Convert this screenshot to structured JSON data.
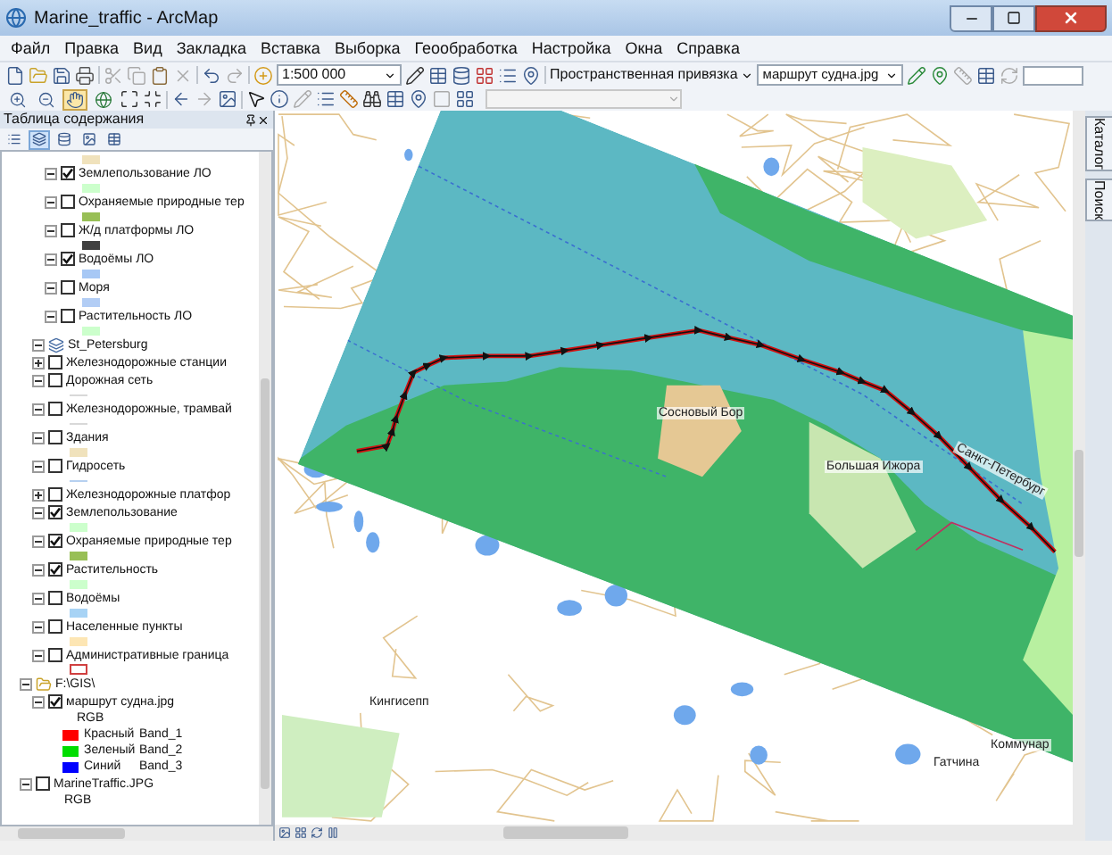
{
  "window": {
    "title": "Marine_traffic - ArcMap"
  },
  "menu": [
    "Файл",
    "Правка",
    "Вид",
    "Закладка",
    "Вставка",
    "Выборка",
    "Геообработка",
    "Настройка",
    "Окна",
    "Справка"
  ],
  "toolbar": {
    "scale": "1:500 000",
    "georef_menu": "Пространственная привязка",
    "georef_layer": "маршрут судна.jpg",
    "navigation_tools": [
      {
        "selected": false
      },
      {
        "selected": false
      },
      {
        "selected": true
      },
      {
        "selected": false
      }
    ]
  },
  "toc": {
    "title": "Таблица содержания",
    "view_buttons": [
      {
        "selected": false
      },
      {
        "selected": true
      },
      {
        "selected": false
      },
      {
        "selected": false
      },
      {
        "selected": false
      }
    ],
    "items": [
      {
        "kind": "legend",
        "swatch": {
          "kind": "fill",
          "color": "#f0e2bc"
        }
      },
      {
        "label": "Землепользование ЛО",
        "checked": true,
        "expanded": true,
        "swatch": {
          "kind": "fill",
          "color": "#ccffcc"
        }
      },
      {
        "label": "Охраняемые природные тер",
        "checked": false,
        "expanded": true,
        "swatch": {
          "kind": "fill",
          "color": "#98bf56"
        }
      },
      {
        "label": "Ж/д платформы ЛО",
        "checked": false,
        "expanded": true,
        "swatch": {
          "kind": "fill",
          "color": "#404040"
        }
      },
      {
        "label": "Водоёмы ЛО",
        "checked": true,
        "expanded": true,
        "swatch": {
          "kind": "fill",
          "color": "#a7c8f5"
        }
      },
      {
        "label": "Моря",
        "checked": false,
        "expanded": true,
        "swatch": {
          "kind": "fill",
          "color": "#b2cdf5"
        }
      },
      {
        "label": "Растительность ЛО",
        "checked": false,
        "expanded": true,
        "swatch": {
          "kind": "fill",
          "color": "#ccffcc"
        }
      },
      {
        "kind": "group",
        "label": "St_Petersburg",
        "expanded": true,
        "children": [
          {
            "label": "Железнодорожные станции",
            "checked": false,
            "expanded": false
          },
          {
            "label": "Дорожная сеть",
            "checked": false,
            "expanded": true,
            "swatch": {
              "kind": "line",
              "color": "#d8d8d8"
            }
          },
          {
            "label": "Железнодорожные, трамвай",
            "checked": false,
            "expanded": true,
            "swatch": {
              "kind": "line",
              "color": "#d8d8d8"
            }
          },
          {
            "label": "Здания",
            "checked": false,
            "expanded": true,
            "swatch": {
              "kind": "fill",
              "color": "#f0e2bc"
            }
          },
          {
            "label": "Гидросеть",
            "checked": false,
            "expanded": true,
            "swatch": {
              "kind": "line",
              "color": "#b6d0f0"
            }
          },
          {
            "label": "Железнодорожные платфор",
            "checked": false,
            "expanded": false
          },
          {
            "label": "Землепользование",
            "checked": true,
            "expanded": true,
            "swatch": {
              "kind": "fill",
              "color": "#ccffcc"
            }
          },
          {
            "label": "Охраняемые природные тер",
            "checked": true,
            "expanded": true,
            "swatch": {
              "kind": "fill",
              "color": "#98bf56"
            }
          },
          {
            "label": "Растительность",
            "checked": true,
            "expanded": true,
            "swatch": {
              "kind": "fill",
              "color": "#ccffcc"
            }
          },
          {
            "label": "Водоёмы",
            "checked": false,
            "expanded": true,
            "swatch": {
              "kind": "fill",
              "color": "#a7d3f5"
            }
          },
          {
            "label": "Населенные пункты",
            "checked": false,
            "expanded": true,
            "swatch": {
              "kind": "fill",
              "color": "#fde6b4"
            }
          },
          {
            "label": "Административные граница",
            "checked": false,
            "expanded": true,
            "swatch": {
              "kind": "outline",
              "color": "#d04040"
            }
          }
        ]
      },
      {
        "kind": "folder",
        "label": "F:\\GIS\\",
        "expanded": true,
        "children": [
          {
            "label": "маршрут судна.jpg",
            "checked": true,
            "expanded": true,
            "renderer": "RGB",
            "bands": [
              {
                "color": "#ff0000",
                "label": "Красный",
                "band": "Band_1"
              },
              {
                "color": "#00dd00",
                "label": "Зеленый",
                "band": "Band_2"
              },
              {
                "color": "#0000ff",
                "label": "Синий",
                "band": "Band_3"
              }
            ]
          }
        ]
      },
      {
        "kind": "raster",
        "label": "MarineTraffic.JPG",
        "checked": false,
        "expanded": true,
        "renderer": "RGB"
      }
    ]
  },
  "map": {
    "labels": [
      "Сосновый Бор",
      "Большая Ижора",
      "Санкт-Петербург",
      "Кингисепп",
      "Гатчина",
      "Коммунар"
    ]
  },
  "dock": [
    "Каталог",
    "Поиск"
  ]
}
